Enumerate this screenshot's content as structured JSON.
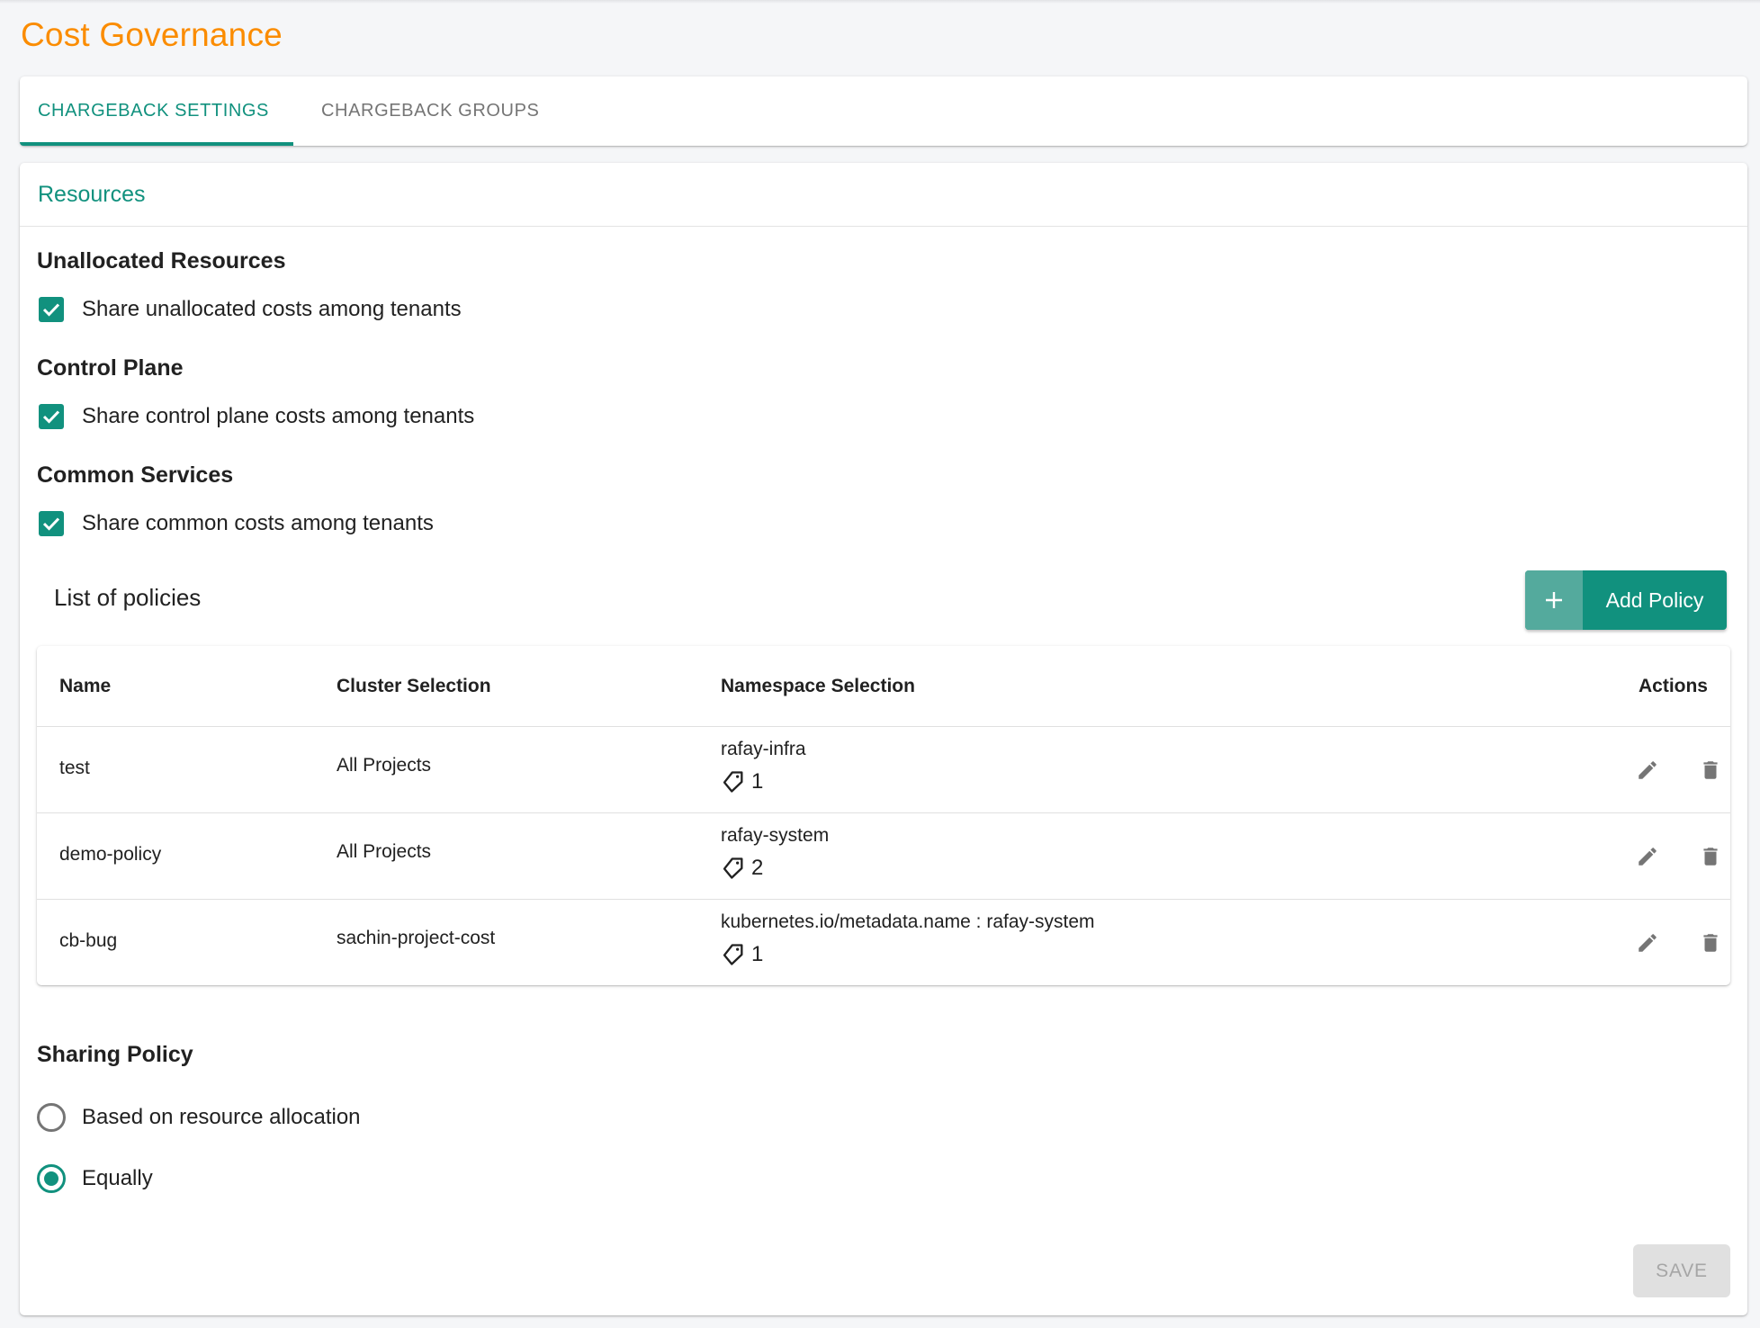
{
  "page": {
    "title": "Cost Governance"
  },
  "colors": {
    "accent": "#11917e",
    "title": "#fb8c00",
    "disabled_bg": "#e0e0e0",
    "icon_gray": "#757575"
  },
  "tabs": [
    {
      "label": "CHARGEBACK SETTINGS",
      "active": true
    },
    {
      "label": "CHARGEBACK GROUPS",
      "active": false
    }
  ],
  "resources": {
    "header": "Resources",
    "groups": [
      {
        "title": "Unallocated Resources",
        "checkbox_label": "Share unallocated costs among tenants",
        "checked": true
      },
      {
        "title": "Control Plane",
        "checkbox_label": "Share control plane costs among tenants",
        "checked": true
      },
      {
        "title": "Common Services",
        "checkbox_label": "Share common costs among tenants",
        "checked": true
      }
    ]
  },
  "policies": {
    "title": "List of policies",
    "add_button": {
      "icon": "plus-icon",
      "label": "Add Policy"
    },
    "columns": [
      "Name",
      "Cluster Selection",
      "Namespace Selection",
      "Actions"
    ],
    "rows": [
      {
        "name": "test",
        "cluster": "All Projects",
        "namespace": "rafay-infra",
        "tag_icon": "tag-icon",
        "tag_count": "1"
      },
      {
        "name": "demo-policy",
        "cluster": "All Projects",
        "namespace": "rafay-system",
        "tag_icon": "tag-icon",
        "tag_count": "2"
      },
      {
        "name": "cb-bug",
        "cluster": "sachin-project-cost",
        "namespace": "kubernetes.io/metadata.name : rafay-system",
        "tag_icon": "tag-icon",
        "tag_count": "1"
      }
    ],
    "row_actions": [
      "edit-icon",
      "delete-icon"
    ]
  },
  "sharing_policy": {
    "title": "Sharing Policy",
    "options": [
      {
        "label": "Based on resource allocation",
        "selected": false
      },
      {
        "label": "Equally",
        "selected": true
      }
    ]
  },
  "footer": {
    "save_label": "SAVE",
    "save_disabled": true
  }
}
